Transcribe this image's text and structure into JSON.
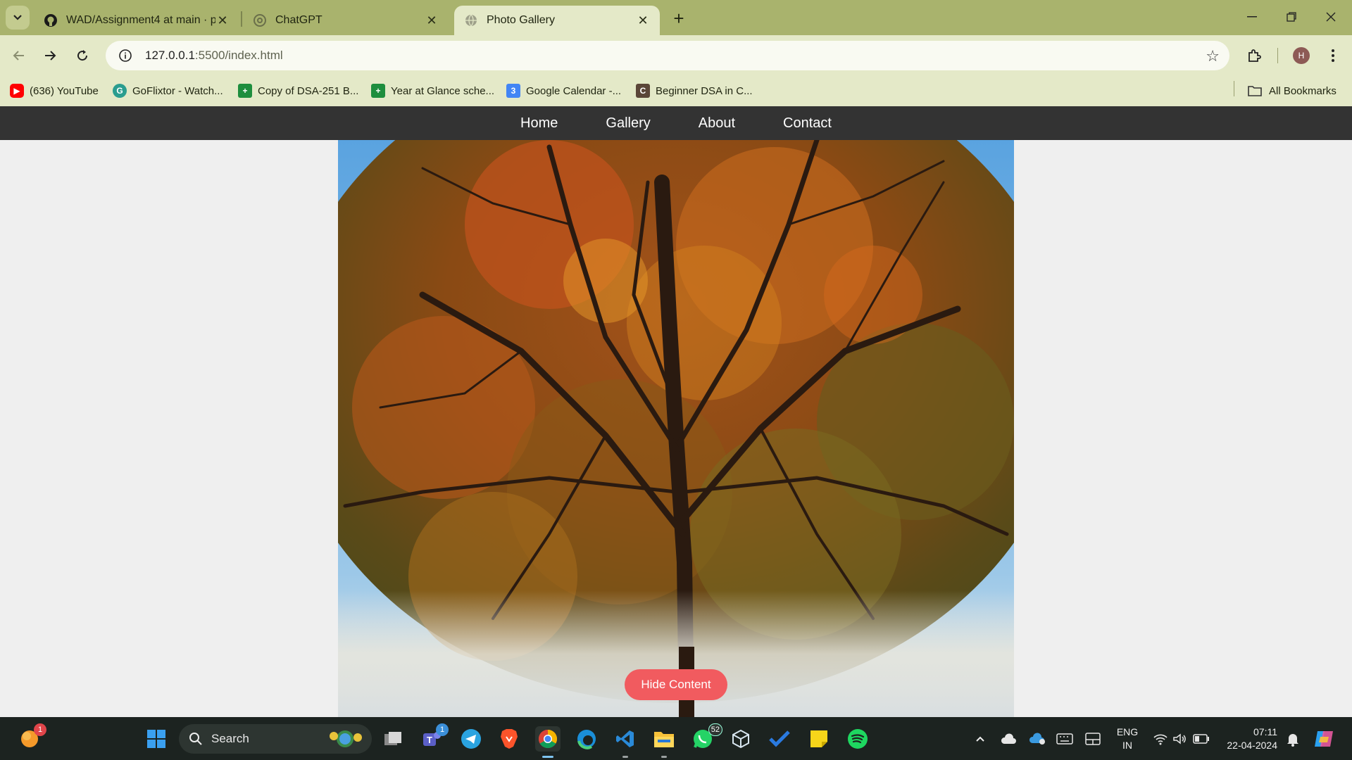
{
  "browser": {
    "tabs": [
      {
        "title": "WAD/Assignment4 at main · p",
        "icon": "github-icon",
        "active": false
      },
      {
        "title": "ChatGPT",
        "icon": "chatgpt-icon",
        "active": false
      },
      {
        "title": "Photo Gallery",
        "icon": "globe-icon",
        "active": true
      }
    ],
    "address": {
      "host": "127.0.0.1",
      "path": ":5500/index.html"
    },
    "profile_initial": "H",
    "bookmarks": [
      {
        "label": "(636) YouTube",
        "icon": "youtube-icon",
        "color": "#ff0000"
      },
      {
        "label": "GoFlixtor - Watch...",
        "icon": "goflixtor-icon",
        "color": "#2a9d8f"
      },
      {
        "label": "Copy of DSA-251 B...",
        "icon": "sheets-icon",
        "color": "#1e8e3e"
      },
      {
        "label": "Year at Glance sche...",
        "icon": "sheets-icon",
        "color": "#1e8e3e"
      },
      {
        "label": "Google Calendar -...",
        "icon": "calendar-icon",
        "color": "#4285f4"
      },
      {
        "label": "Beginner DSA in C...",
        "icon": "codechef-icon",
        "color": "#5b4638"
      }
    ],
    "all_bookmarks": "All Bookmarks"
  },
  "site": {
    "nav": [
      "Home",
      "Gallery",
      "About",
      "Contact"
    ],
    "hide_button": "Hide Content",
    "photo_alt": "autumn-tree-photo"
  },
  "taskbar": {
    "search_label": "Search",
    "teams_badge": "1",
    "whatsapp_badge": "52",
    "weather_badge": "1",
    "lang_line1": "ENG",
    "lang_line2": "IN",
    "time": "07:11",
    "date": "22-04-2024"
  },
  "colors": {
    "tabstrip": "#a9b36d",
    "toolbar": "#e4e9c8",
    "site_nav": "#333333",
    "hide_button": "#f15b5f",
    "taskbar": "#1c2320"
  }
}
